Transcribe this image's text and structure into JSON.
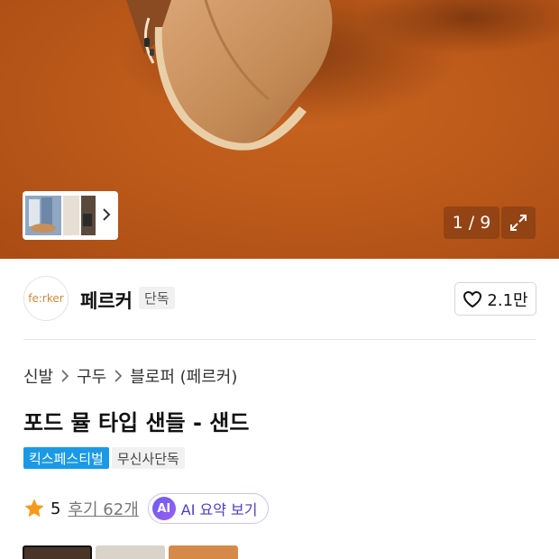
{
  "gallery": {
    "counter": "1 / 9",
    "thumbnail_icon": "thumbnail-strip",
    "expand_icon": "expand-icon",
    "background_color": "#bd5a1a"
  },
  "brand": {
    "logo_text": "fe:rker",
    "name": "페르커",
    "exclusive_label": "단독",
    "like_count": "2.1만"
  },
  "breadcrumb": {
    "items": [
      "신발",
      "구두",
      "블로퍼 (페르커)"
    ]
  },
  "product": {
    "title": "포드 뮬 타입 샌들 - 샌드"
  },
  "badges": {
    "festival": "킥스페스티벌",
    "store": "무신사단독"
  },
  "rating": {
    "score": "5",
    "review_label": "후기 62개",
    "ai_icon_text": "AI",
    "ai_label": "AI 요약 보기"
  },
  "colors": {
    "accent_festival": "#1a9ae6",
    "ai_purple": "#6b5cf0",
    "star": "#f59a1b"
  }
}
